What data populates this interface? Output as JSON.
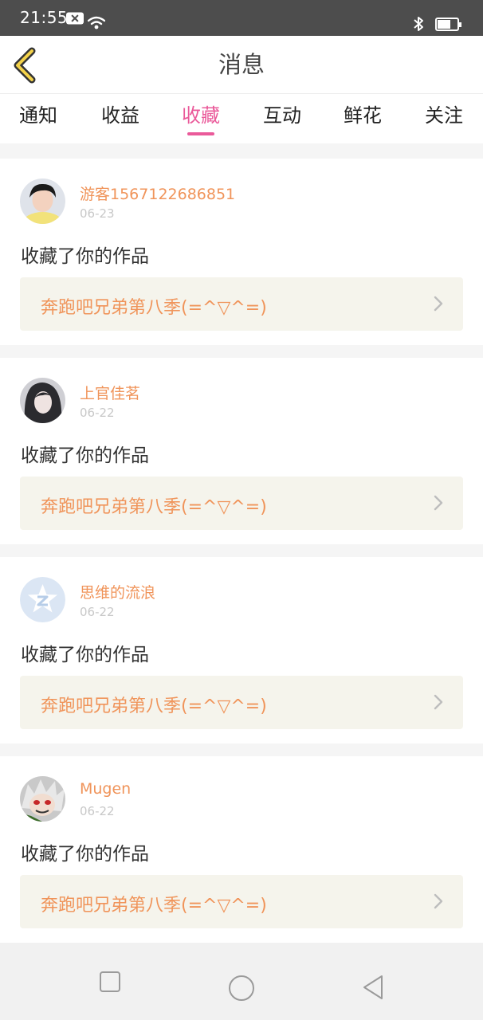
{
  "status_bar": {
    "time": "21:55"
  },
  "header": {
    "title": "消息"
  },
  "tabs": [
    {
      "label": "通知"
    },
    {
      "label": "收益"
    },
    {
      "label": "收藏"
    },
    {
      "label": "互动"
    },
    {
      "label": "鲜花"
    },
    {
      "label": "关注"
    }
  ],
  "active_tab": "收藏",
  "notifications": [
    {
      "user": "游客1567122686851",
      "date": "06-23",
      "action": "收藏了你的作品",
      "work_title": "奔跑吧兄弟第八季(=^▽^=)"
    },
    {
      "user": "上官佳茗",
      "date": "06-22",
      "action": "收藏了你的作品",
      "work_title": "奔跑吧兄弟第八季(=^▽^=)"
    },
    {
      "user": "思维的流浪",
      "date": "06-22",
      "action": "收藏了你的作品",
      "work_title": "奔跑吧兄弟第八季(=^▽^=)"
    },
    {
      "user": "Mugen",
      "date": "06-22",
      "action": "收藏了你的作品",
      "work_title": "奔跑吧兄弟第八季(=^▽^=)"
    }
  ],
  "colors": {
    "accent": "#ea5a9a",
    "username": "#f0945a",
    "status_bar": "#4d4d4d",
    "work_link_bg": "#f5f4ec"
  },
  "icons": {
    "back": "back-arrow-icon",
    "chevron": "chevron-right-icon",
    "nav": [
      "recent-apps-icon",
      "home-icon",
      "back-nav-icon"
    ]
  }
}
